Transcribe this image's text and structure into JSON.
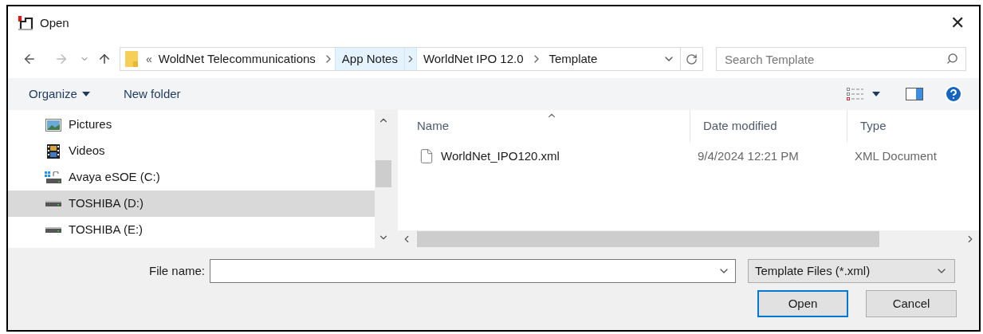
{
  "window": {
    "title": "Open",
    "close": "✕"
  },
  "address_bar": {
    "overflow": "«",
    "segments": [
      {
        "label": "WoldNet Telecommunications",
        "selected": false
      },
      {
        "label": "App Notes",
        "selected": true
      },
      {
        "label": "WorldNet IPO 12.0",
        "selected": false
      },
      {
        "label": "Template",
        "selected": false
      }
    ]
  },
  "search": {
    "placeholder": "Search Template"
  },
  "toolbar": {
    "organize": "Organize",
    "new_folder": "New folder"
  },
  "sidebar": {
    "items": [
      {
        "label": "Pictures",
        "kind": "pictures",
        "selected": false
      },
      {
        "label": "Videos",
        "kind": "videos",
        "selected": false
      },
      {
        "label": "Avaya eSOE (C:)",
        "kind": "system-drive",
        "selected": false
      },
      {
        "label": "TOSHIBA (D:)",
        "kind": "drive",
        "selected": true
      },
      {
        "label": "TOSHIBA (E:)",
        "kind": "drive",
        "selected": false
      }
    ]
  },
  "file_list": {
    "columns": [
      "Name",
      "Date modified",
      "Type"
    ],
    "rows": [
      {
        "name": "WorldNet_IPO120.xml",
        "date_modified": "9/4/2024 12:21 PM",
        "type": "XML Document"
      }
    ]
  },
  "file_name": {
    "label": "File name:"
  },
  "file_type": {
    "value": "Template Files (*.xml)"
  },
  "buttons": [
    {
      "label": "Open",
      "default": true
    },
    {
      "label": "Cancel",
      "default": false
    }
  ]
}
